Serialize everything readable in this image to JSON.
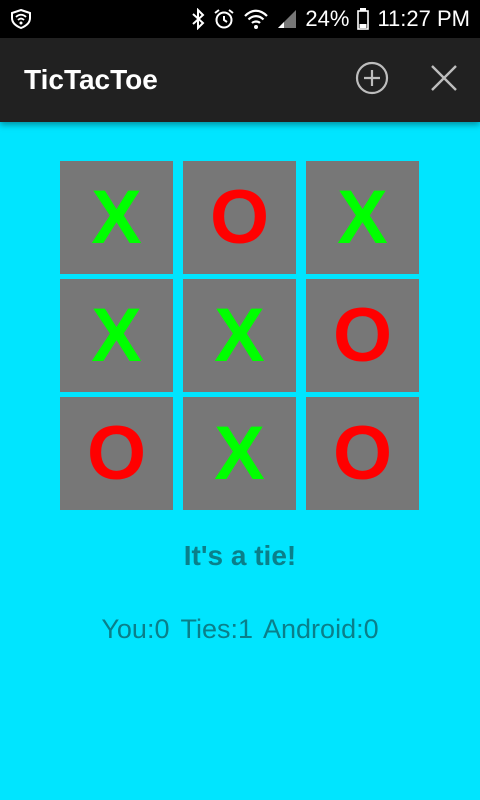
{
  "status_bar": {
    "battery_percent": "24%",
    "time": "11:27 PM",
    "icons": [
      "shield-icon",
      "bluetooth-icon",
      "alarm-icon",
      "wifi-icon",
      "signal-icon",
      "battery-icon"
    ]
  },
  "action_bar": {
    "title": "TicTacToe",
    "new_game_icon": "add-circle-icon",
    "quit_icon": "close-icon"
  },
  "board": {
    "cells": [
      "X",
      "O",
      "X",
      "X",
      "X",
      "O",
      "O",
      "X",
      "O"
    ]
  },
  "result": "It's a tie!",
  "score": "You:0  Ties:1  Android:0",
  "colors": {
    "background": "#00e5ff",
    "cell": "#777777",
    "x_mark": "#00ff00",
    "o_mark": "#ff0000",
    "text": "#0a7f8a",
    "action_bar": "#212121"
  }
}
